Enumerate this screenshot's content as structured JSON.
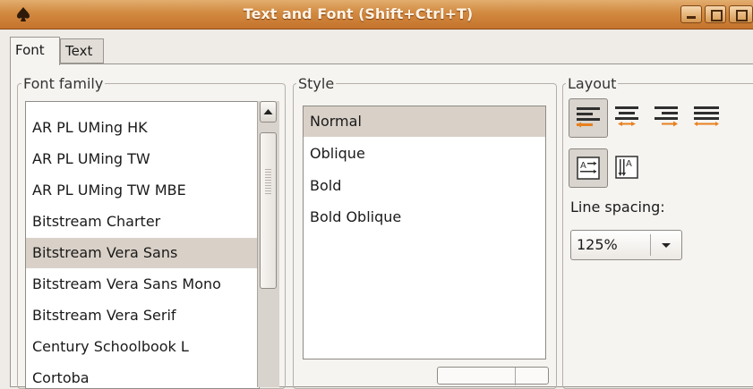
{
  "window": {
    "title": "Text and Font (Shift+Ctrl+T)",
    "icon": "spade-icon",
    "controls": [
      "minimize-icon",
      "maximize-icon",
      "close-icon"
    ]
  },
  "tabs": [
    {
      "label": "Font",
      "active": true
    },
    {
      "label": "Text",
      "active": false
    }
  ],
  "font_family": {
    "label": "Font family",
    "items": [
      {
        "label": "AR PL UMing HK"
      },
      {
        "label": "AR PL UMing TW"
      },
      {
        "label": "AR PL UMing TW MBE"
      },
      {
        "label": "Bitstream Charter"
      },
      {
        "label": "Bitstream Vera Sans",
        "selected": true
      },
      {
        "label": "Bitstream Vera Sans Mono"
      },
      {
        "label": "Bitstream Vera Serif"
      },
      {
        "label": "Century Schoolbook L"
      },
      {
        "label": "Cortoba"
      }
    ]
  },
  "style": {
    "label": "Style",
    "items": [
      {
        "label": "Normal",
        "selected": true
      },
      {
        "label": "Oblique"
      },
      {
        "label": "Bold"
      },
      {
        "label": "Bold Oblique"
      }
    ]
  },
  "layout": {
    "label": "Layout",
    "alignment_buttons": [
      "align-left-icon",
      "align-center-icon",
      "align-right-icon",
      "align-justify-icon"
    ],
    "orientation_buttons": [
      "horizontal-text-icon",
      "vertical-text-icon"
    ],
    "line_spacing_label": "Line spacing:",
    "line_spacing_value": "125%"
  },
  "colors": {
    "titlebar": "#d28940",
    "accent_orange": "#e8801e",
    "selection": "#d9d1c8"
  }
}
